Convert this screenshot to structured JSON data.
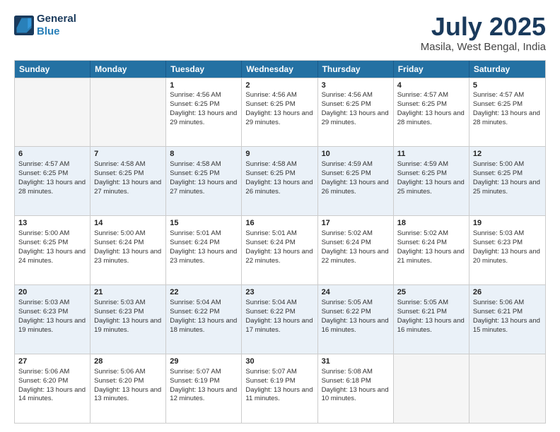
{
  "logo": {
    "line1": "General",
    "line2": "Blue"
  },
  "title": "July 2025",
  "subtitle": "Masila, West Bengal, India",
  "weekdays": [
    "Sunday",
    "Monday",
    "Tuesday",
    "Wednesday",
    "Thursday",
    "Friday",
    "Saturday"
  ],
  "weeks": [
    [
      {
        "day": "",
        "info": ""
      },
      {
        "day": "",
        "info": ""
      },
      {
        "day": "1",
        "info": "Sunrise: 4:56 AM\nSunset: 6:25 PM\nDaylight: 13 hours and 29 minutes."
      },
      {
        "day": "2",
        "info": "Sunrise: 4:56 AM\nSunset: 6:25 PM\nDaylight: 13 hours and 29 minutes."
      },
      {
        "day": "3",
        "info": "Sunrise: 4:56 AM\nSunset: 6:25 PM\nDaylight: 13 hours and 29 minutes."
      },
      {
        "day": "4",
        "info": "Sunrise: 4:57 AM\nSunset: 6:25 PM\nDaylight: 13 hours and 28 minutes."
      },
      {
        "day": "5",
        "info": "Sunrise: 4:57 AM\nSunset: 6:25 PM\nDaylight: 13 hours and 28 minutes."
      }
    ],
    [
      {
        "day": "6",
        "info": "Sunrise: 4:57 AM\nSunset: 6:25 PM\nDaylight: 13 hours and 28 minutes."
      },
      {
        "day": "7",
        "info": "Sunrise: 4:58 AM\nSunset: 6:25 PM\nDaylight: 13 hours and 27 minutes."
      },
      {
        "day": "8",
        "info": "Sunrise: 4:58 AM\nSunset: 6:25 PM\nDaylight: 13 hours and 27 minutes."
      },
      {
        "day": "9",
        "info": "Sunrise: 4:58 AM\nSunset: 6:25 PM\nDaylight: 13 hours and 26 minutes."
      },
      {
        "day": "10",
        "info": "Sunrise: 4:59 AM\nSunset: 6:25 PM\nDaylight: 13 hours and 26 minutes."
      },
      {
        "day": "11",
        "info": "Sunrise: 4:59 AM\nSunset: 6:25 PM\nDaylight: 13 hours and 25 minutes."
      },
      {
        "day": "12",
        "info": "Sunrise: 5:00 AM\nSunset: 6:25 PM\nDaylight: 13 hours and 25 minutes."
      }
    ],
    [
      {
        "day": "13",
        "info": "Sunrise: 5:00 AM\nSunset: 6:25 PM\nDaylight: 13 hours and 24 minutes."
      },
      {
        "day": "14",
        "info": "Sunrise: 5:00 AM\nSunset: 6:24 PM\nDaylight: 13 hours and 23 minutes."
      },
      {
        "day": "15",
        "info": "Sunrise: 5:01 AM\nSunset: 6:24 PM\nDaylight: 13 hours and 23 minutes."
      },
      {
        "day": "16",
        "info": "Sunrise: 5:01 AM\nSunset: 6:24 PM\nDaylight: 13 hours and 22 minutes."
      },
      {
        "day": "17",
        "info": "Sunrise: 5:02 AM\nSunset: 6:24 PM\nDaylight: 13 hours and 22 minutes."
      },
      {
        "day": "18",
        "info": "Sunrise: 5:02 AM\nSunset: 6:24 PM\nDaylight: 13 hours and 21 minutes."
      },
      {
        "day": "19",
        "info": "Sunrise: 5:03 AM\nSunset: 6:23 PM\nDaylight: 13 hours and 20 minutes."
      }
    ],
    [
      {
        "day": "20",
        "info": "Sunrise: 5:03 AM\nSunset: 6:23 PM\nDaylight: 13 hours and 19 minutes."
      },
      {
        "day": "21",
        "info": "Sunrise: 5:03 AM\nSunset: 6:23 PM\nDaylight: 13 hours and 19 minutes."
      },
      {
        "day": "22",
        "info": "Sunrise: 5:04 AM\nSunset: 6:22 PM\nDaylight: 13 hours and 18 minutes."
      },
      {
        "day": "23",
        "info": "Sunrise: 5:04 AM\nSunset: 6:22 PM\nDaylight: 13 hours and 17 minutes."
      },
      {
        "day": "24",
        "info": "Sunrise: 5:05 AM\nSunset: 6:22 PM\nDaylight: 13 hours and 16 minutes."
      },
      {
        "day": "25",
        "info": "Sunrise: 5:05 AM\nSunset: 6:21 PM\nDaylight: 13 hours and 16 minutes."
      },
      {
        "day": "26",
        "info": "Sunrise: 5:06 AM\nSunset: 6:21 PM\nDaylight: 13 hours and 15 minutes."
      }
    ],
    [
      {
        "day": "27",
        "info": "Sunrise: 5:06 AM\nSunset: 6:20 PM\nDaylight: 13 hours and 14 minutes."
      },
      {
        "day": "28",
        "info": "Sunrise: 5:06 AM\nSunset: 6:20 PM\nDaylight: 13 hours and 13 minutes."
      },
      {
        "day": "29",
        "info": "Sunrise: 5:07 AM\nSunset: 6:19 PM\nDaylight: 13 hours and 12 minutes."
      },
      {
        "day": "30",
        "info": "Sunrise: 5:07 AM\nSunset: 6:19 PM\nDaylight: 13 hours and 11 minutes."
      },
      {
        "day": "31",
        "info": "Sunrise: 5:08 AM\nSunset: 6:18 PM\nDaylight: 13 hours and 10 minutes."
      },
      {
        "day": "",
        "info": ""
      },
      {
        "day": "",
        "info": ""
      }
    ]
  ]
}
